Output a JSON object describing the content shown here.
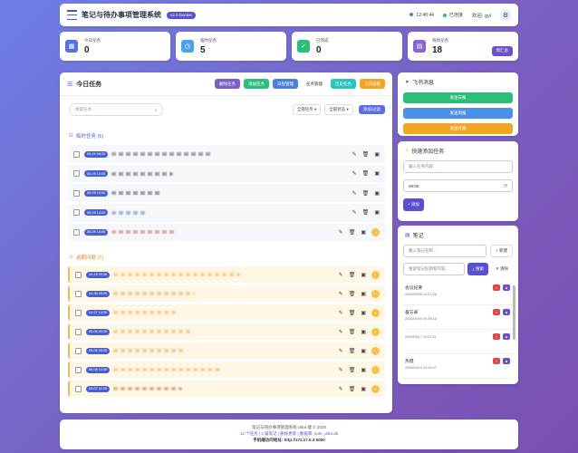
{
  "header": {
    "title": "笔记与待办事项管理系统",
    "version": "v2.0 Docker",
    "time": "12:48:44",
    "status": "已连接",
    "welcome": "欢迎, gyl"
  },
  "stats": [
    {
      "label": "今日任务",
      "value": "0",
      "color": "#5b6fe0",
      "icon": "calendar-icon"
    },
    {
      "label": "临时任务",
      "value": "5",
      "color": "#4aa3e8",
      "icon": "clock-icon"
    },
    {
      "label": "已完成",
      "value": "0",
      "color": "#2bbf7a",
      "icon": "check-icon"
    },
    {
      "label": "每周任务",
      "value": "18",
      "color": "#8a62d2",
      "icon": "calendar-week-icon",
      "button": "周汇总"
    }
  ],
  "main": {
    "title": "今日任务",
    "tabs": [
      {
        "label": "删除任务",
        "color": "#7a5fc8"
      },
      {
        "label": "添加任务",
        "color": "#2bbf7a"
      },
      {
        "label": "日程管理",
        "color": "#4a7fe0"
      },
      {
        "label": "任务管理",
        "color": "#ffffff"
      },
      {
        "label": "历史任务",
        "color": "#2ac3c3"
      },
      {
        "label": "工作日报",
        "color": "#f5a524"
      }
    ],
    "search_placeholder": "搜索任务...",
    "filter1": "全部任务",
    "filter2": "全部状态",
    "filter_btn": "添加/过滤",
    "sec1": "临时任务 (5)",
    "sec2": "逾期问题 (7)",
    "temp": [
      {
        "date": "05-09 08:00",
        "w": 110,
        "c": "#667"
      },
      {
        "date": "05-09 10:00",
        "w": 68,
        "c": "#556"
      },
      {
        "date": "05-09 10:00",
        "w": 56,
        "c": "#556"
      },
      {
        "date": "05-09 14:00",
        "w": 40,
        "c": "#7788bb"
      },
      {
        "date": "05-09 16:00",
        "w": 72,
        "c": "#d07070"
      }
    ],
    "over": [
      {
        "date": "04-28 09:30",
        "w": 140,
        "c": "#f0b060"
      },
      {
        "date": "04-30 09:30",
        "w": 90,
        "c": "#f0b060"
      },
      {
        "date": "04-27 13:30",
        "w": 70,
        "c": "#f0b060"
      },
      {
        "date": "05-06 09:30",
        "w": 88,
        "c": "#f0b060"
      },
      {
        "date": "05-06 09:30",
        "w": 80,
        "c": "#f0b060"
      },
      {
        "date": "05-08 10:30",
        "w": 120,
        "c": "#f0b060"
      },
      {
        "date": "05-07 11:00",
        "w": 76,
        "c": "#d08050"
      }
    ]
  },
  "feishu": {
    "title": "飞书消息",
    "buttons": [
      {
        "label": "发送日报",
        "color": "#2bbf7a"
      },
      {
        "label": "发送周报",
        "color": "#4a8fe8"
      },
      {
        "label": "发送月报",
        "color": "#f5a524"
      }
    ]
  },
  "quickadd": {
    "title": "快速添加任务",
    "placeholder": "输入任务内容...",
    "time": "09:00",
    "button": "+ 添加"
  },
  "notes": {
    "title": "笔记",
    "name_placeholder": "输入笔记名称...",
    "new_btn": "+ 新建",
    "search_placeholder": "搜索笔记标题和内容...",
    "search_btn": "搜索",
    "clear_btn": "✕ 清除",
    "items": [
      {
        "title": "会议纪要",
        "date": "2026/05/09 12:47:56"
      },
      {
        "title": "备忘录",
        "date": "2026/05/09 09:35:16"
      },
      {
        "title": "",
        "date": "2026/04/17 11:22:31"
      },
      {
        "title": "热键",
        "date": "2026/04/13 12:50:47"
      }
    ]
  },
  "footer": {
    "line1": "笔记与待办事项管理系统 Ultra 版 © 2025",
    "line2": "12 个任务 | 4 篇笔记 | 删除更新 | 数据库: note_ultra.db",
    "line3": "手机端访问地址: http://172.17.0.3:5000"
  }
}
